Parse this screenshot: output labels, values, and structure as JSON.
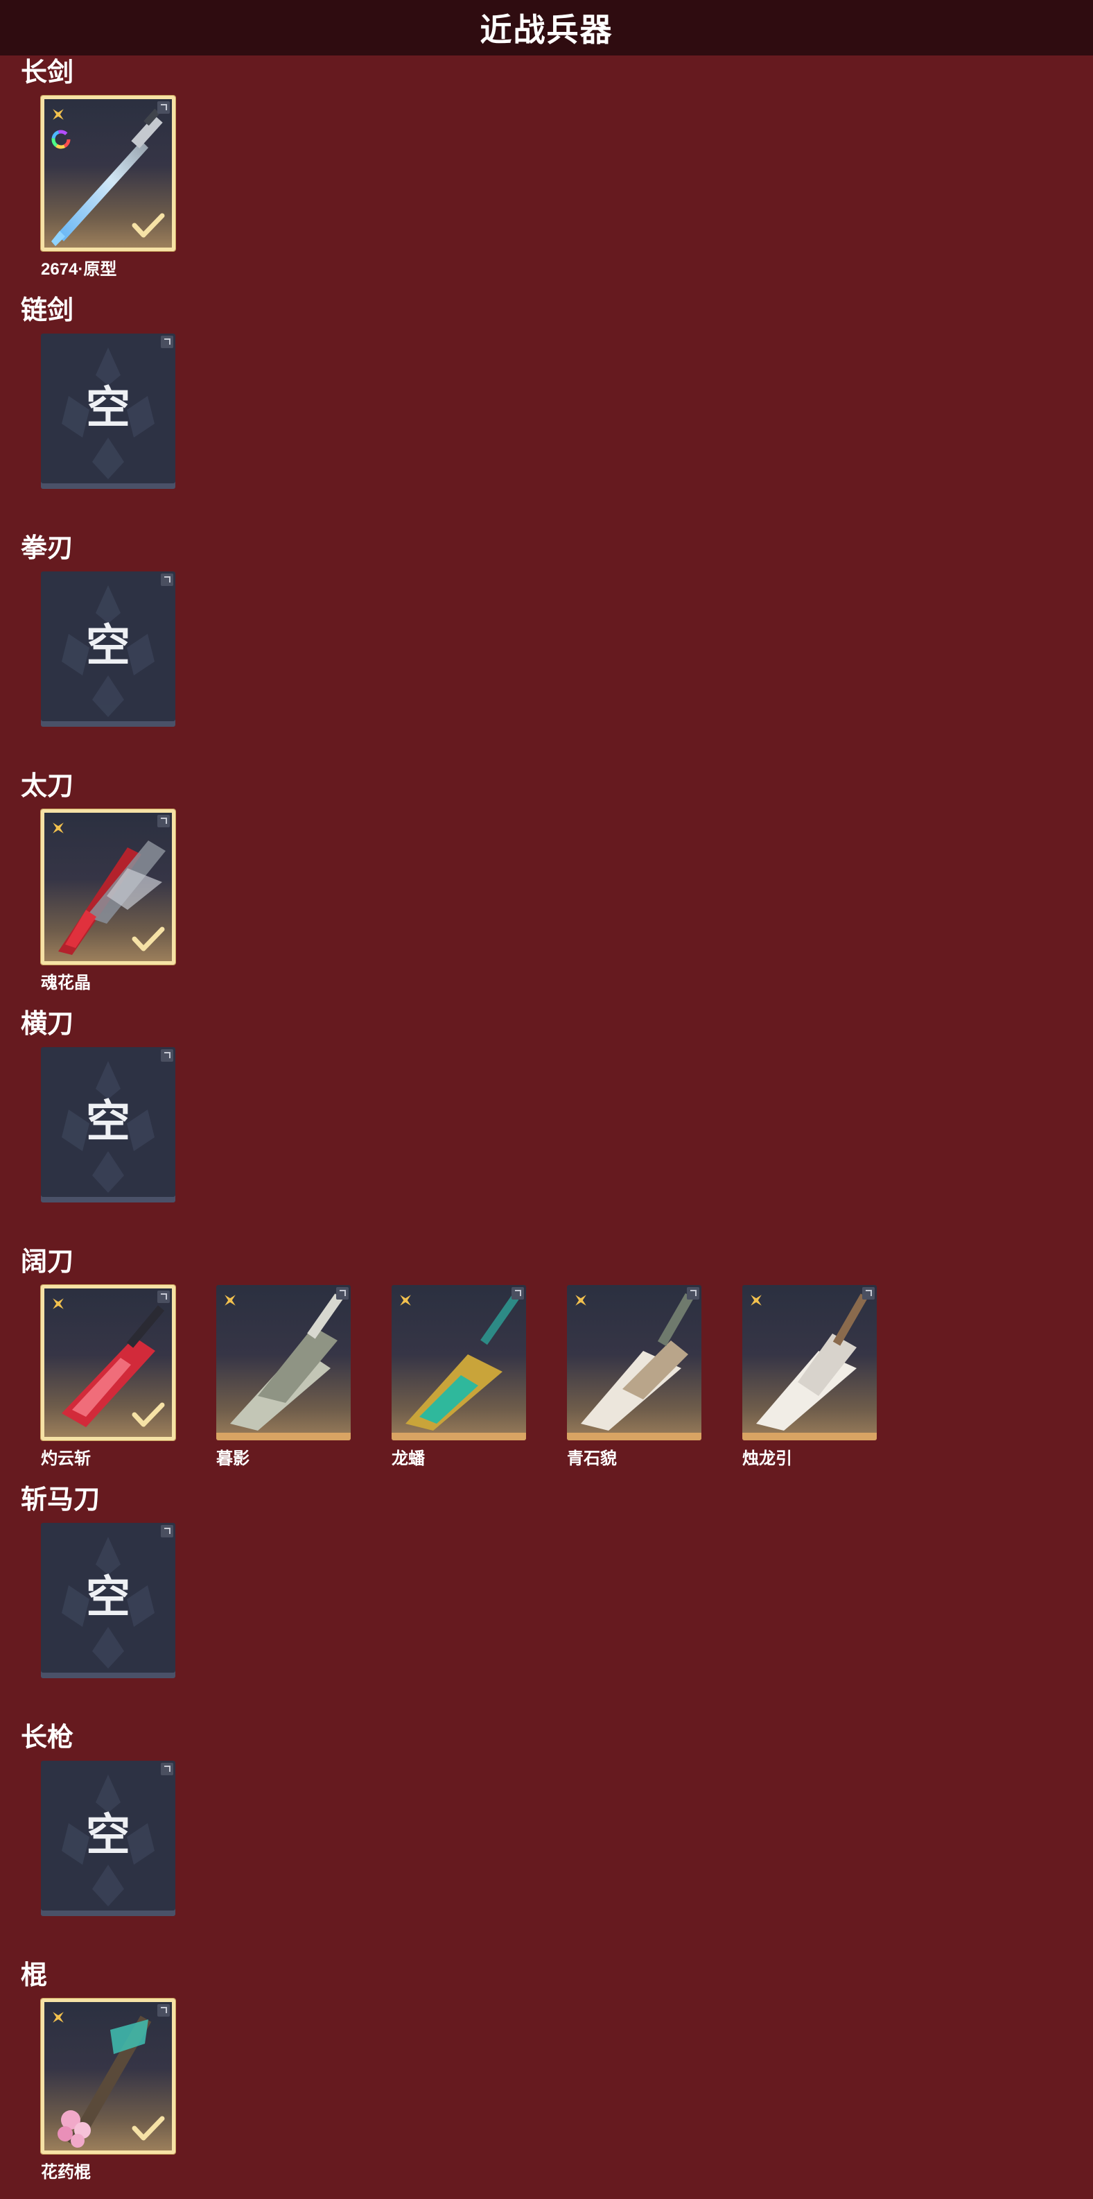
{
  "header": {
    "title": "近战兵器"
  },
  "empty_label": "空",
  "categories": [
    {
      "name": "长剑",
      "items": [
        {
          "name": "2674·原型",
          "selected": true,
          "badge": "rainbow-ring-icon",
          "art": "blue-blade"
        }
      ]
    },
    {
      "name": "链剑",
      "items": []
    },
    {
      "name": "拳刃",
      "items": []
    },
    {
      "name": "太刀",
      "items": [
        {
          "name": "魂花晶",
          "selected": true,
          "art": "crimson-crystal-blade"
        }
      ]
    },
    {
      "name": "横刀",
      "items": []
    },
    {
      "name": "阔刀",
      "items": [
        {
          "name": "灼云斩",
          "selected": true,
          "art": "crimson-broadsword"
        },
        {
          "name": "暮影",
          "selected": false,
          "art": "silver-broadsword"
        },
        {
          "name": "龙蟠",
          "selected": false,
          "art": "gold-jade-broadsword"
        },
        {
          "name": "青石貌",
          "selected": false,
          "art": "white-beast-broadsword"
        },
        {
          "name": "烛龙引",
          "selected": false,
          "art": "ivory-dragon-broadsword"
        }
      ]
    },
    {
      "name": "斩马刀",
      "items": []
    },
    {
      "name": "长枪",
      "items": []
    },
    {
      "name": "棍",
      "items": [
        {
          "name": "花药棍",
          "selected": true,
          "art": "blossom-staff"
        }
      ]
    }
  ],
  "colors": {
    "background": "#661a1f",
    "header": "#2f0c10",
    "selected_border": "#f6e2a6",
    "rarity_gold": "#f2c14e",
    "empty_card": "#2d3244"
  }
}
